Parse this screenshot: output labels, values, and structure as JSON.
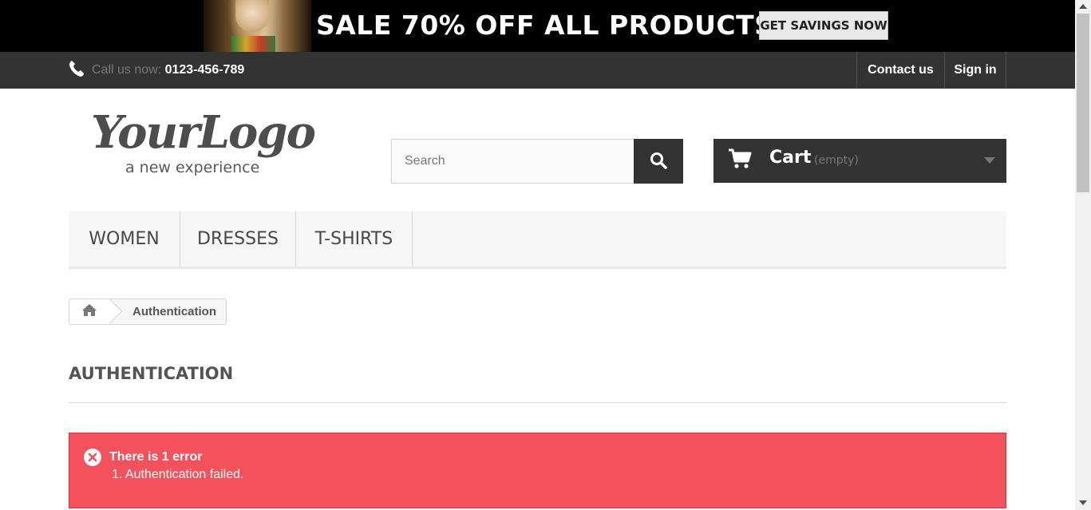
{
  "promo": {
    "title": "SALE 70% OFF ALL PRODUCTS",
    "button": "GET SAVINGS NOW"
  },
  "topbar": {
    "call_label": "Call us now:",
    "phone": "0123-456-789",
    "contact": "Contact us",
    "signin": "Sign in"
  },
  "logo": {
    "main": "YourLogo",
    "tagline": "a new experience"
  },
  "search": {
    "placeholder": "Search",
    "value": ""
  },
  "cart": {
    "label": "Cart",
    "status": "(empty)"
  },
  "menu": {
    "items": [
      "WOMEN",
      "DRESSES",
      "T-SHIRTS"
    ]
  },
  "breadcrumb": {
    "current": "Authentication"
  },
  "page": {
    "heading": "AUTHENTICATION"
  },
  "alert": {
    "title": "There is 1 error",
    "items": [
      "1. Authentication failed."
    ]
  },
  "colors": {
    "dark": "#333333",
    "alert_bg": "#f3515c",
    "menu_bg": "#f6f6f6"
  },
  "icons": [
    "phone-icon",
    "search-icon",
    "cart-icon",
    "chevron-down-icon",
    "home-icon",
    "error-icon"
  ]
}
